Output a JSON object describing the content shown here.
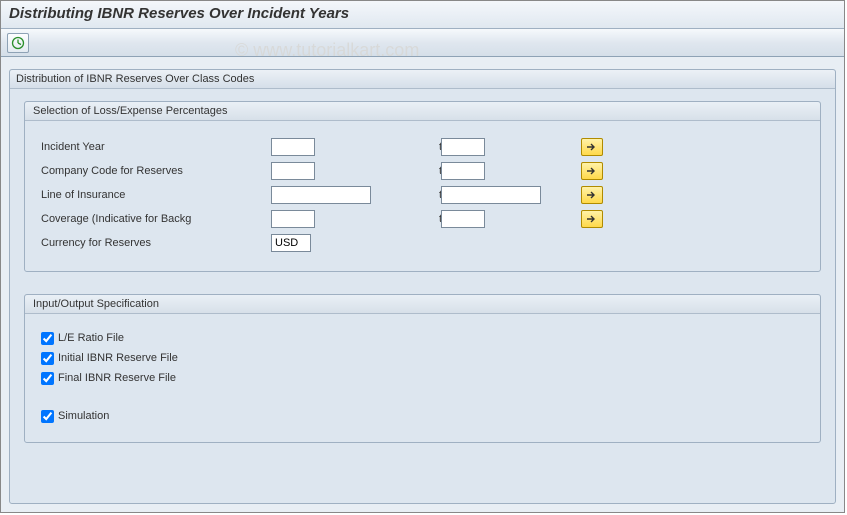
{
  "header": {
    "title": "Distributing IBNR Reserves Over Incident Years"
  },
  "watermark": "© www.tutorialkart.com",
  "outer_group": {
    "title": "Distribution of IBNR Reserves Over Class Codes"
  },
  "selection": {
    "title": "Selection of Loss/Expense Percentages",
    "to_label": "to",
    "rows": {
      "incident_year": {
        "label": "Incident Year",
        "from": "",
        "to": ""
      },
      "company_code": {
        "label": "Company Code for Reserves",
        "from": "",
        "to": ""
      },
      "line_of_insurance": {
        "label": "Line of Insurance",
        "from": "",
        "to": ""
      },
      "coverage": {
        "label": "Coverage (Indicative for Backg",
        "from": "",
        "to": ""
      },
      "currency": {
        "label": "Currency for Reserves",
        "value": "USD"
      }
    }
  },
  "io_spec": {
    "title": "Input/Output Specification",
    "le_ratio": {
      "label": "L/E Ratio File",
      "checked": true
    },
    "initial_ibnr": {
      "label": "Initial IBNR Reserve File",
      "checked": true
    },
    "final_ibnr": {
      "label": "Final IBNR Reserve File",
      "checked": true
    },
    "simulation": {
      "label": "Simulation",
      "checked": true
    }
  }
}
